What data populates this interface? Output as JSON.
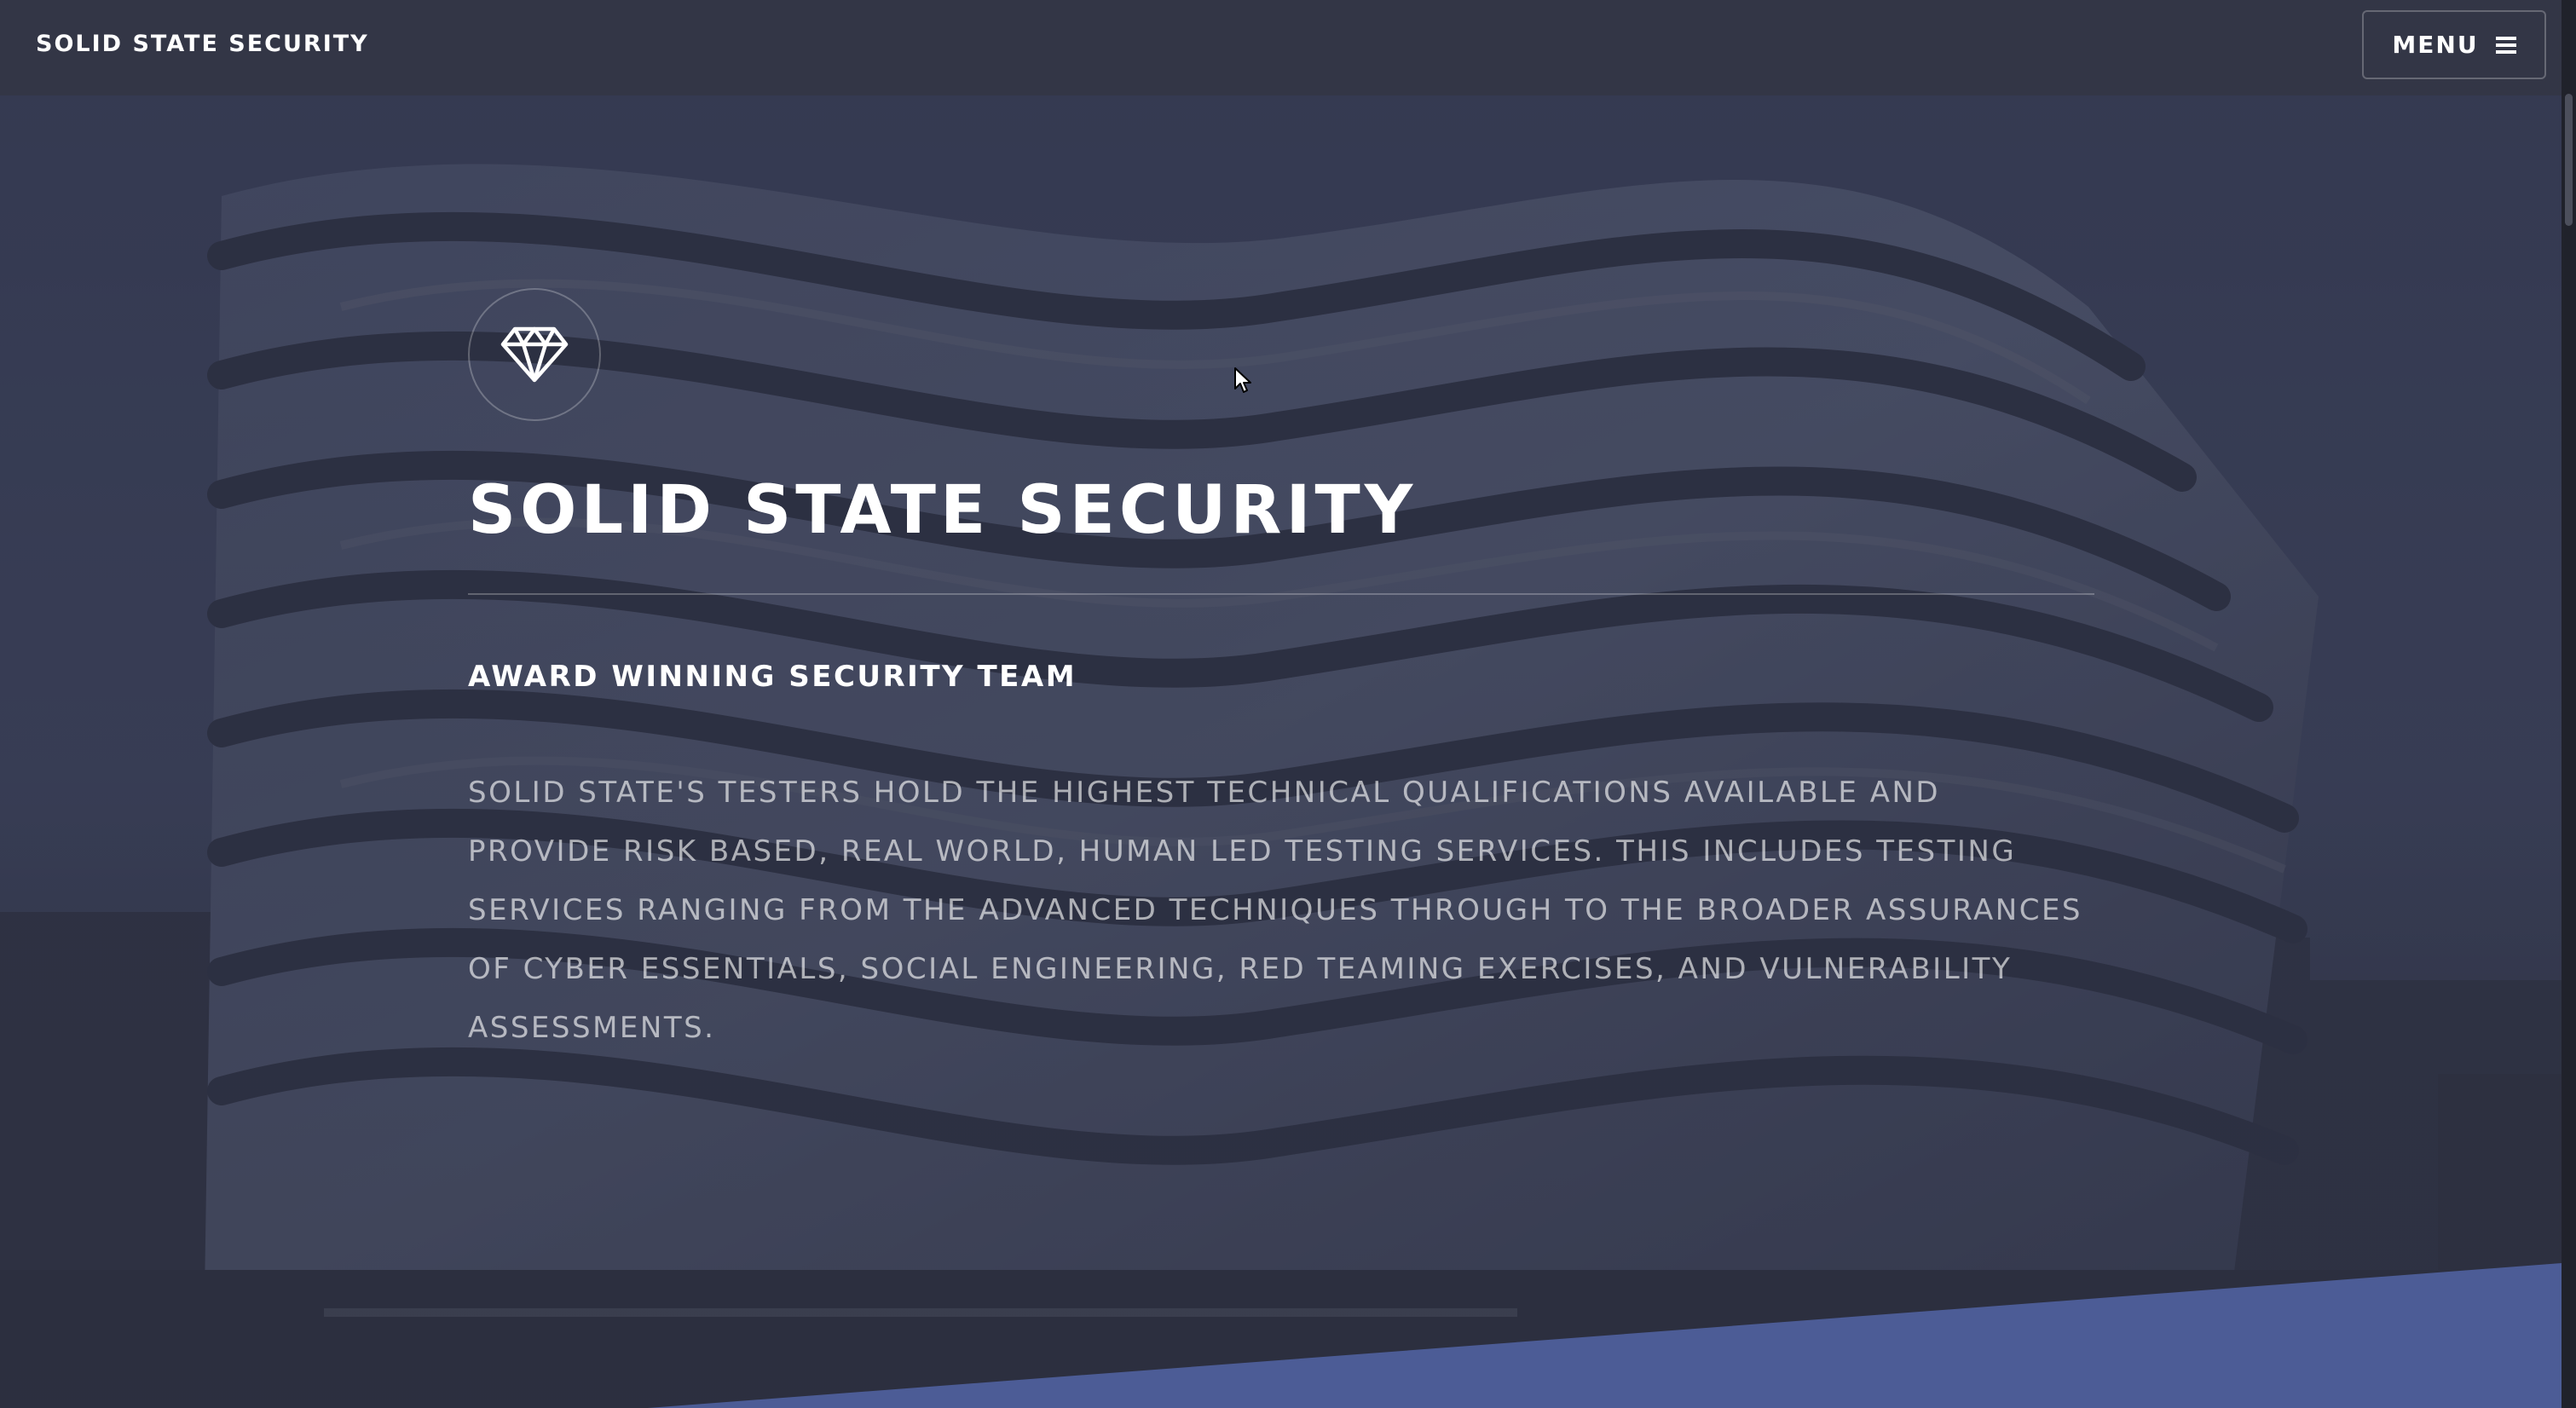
{
  "header": {
    "brand": "SOLID STATE SECURITY",
    "menu_label": "MENU",
    "menu_icon": "hamburger-icon"
  },
  "banner": {
    "logo_icon": "diamond-icon",
    "title": "SOLID STATE SECURITY",
    "subtitle": "AWARD WINNING SECURITY TEAM",
    "description": "SOLID STATE'S TESTERS HOLD THE HIGHEST TECHNICAL QUALIFICATIONS AVAILABLE AND PROVIDE RISK BASED, REAL WORLD, HUMAN LED TESTING SERVICES. THIS INCLUDES TESTING SERVICES RANGING FROM THE ADVANCED TECHNIQUES THROUGH TO THE BROADER ASSURANCES OF CYBER ESSENTIALS, SOCIAL ENGINEERING, RED TEAMING EXERCISES, AND VULNERABILITY ASSESSMENTS."
  },
  "colors": {
    "header_bg": "#333646",
    "overlay": "#2e3141",
    "accent_wedge": "#4c5c96",
    "text": "#ffffff"
  }
}
